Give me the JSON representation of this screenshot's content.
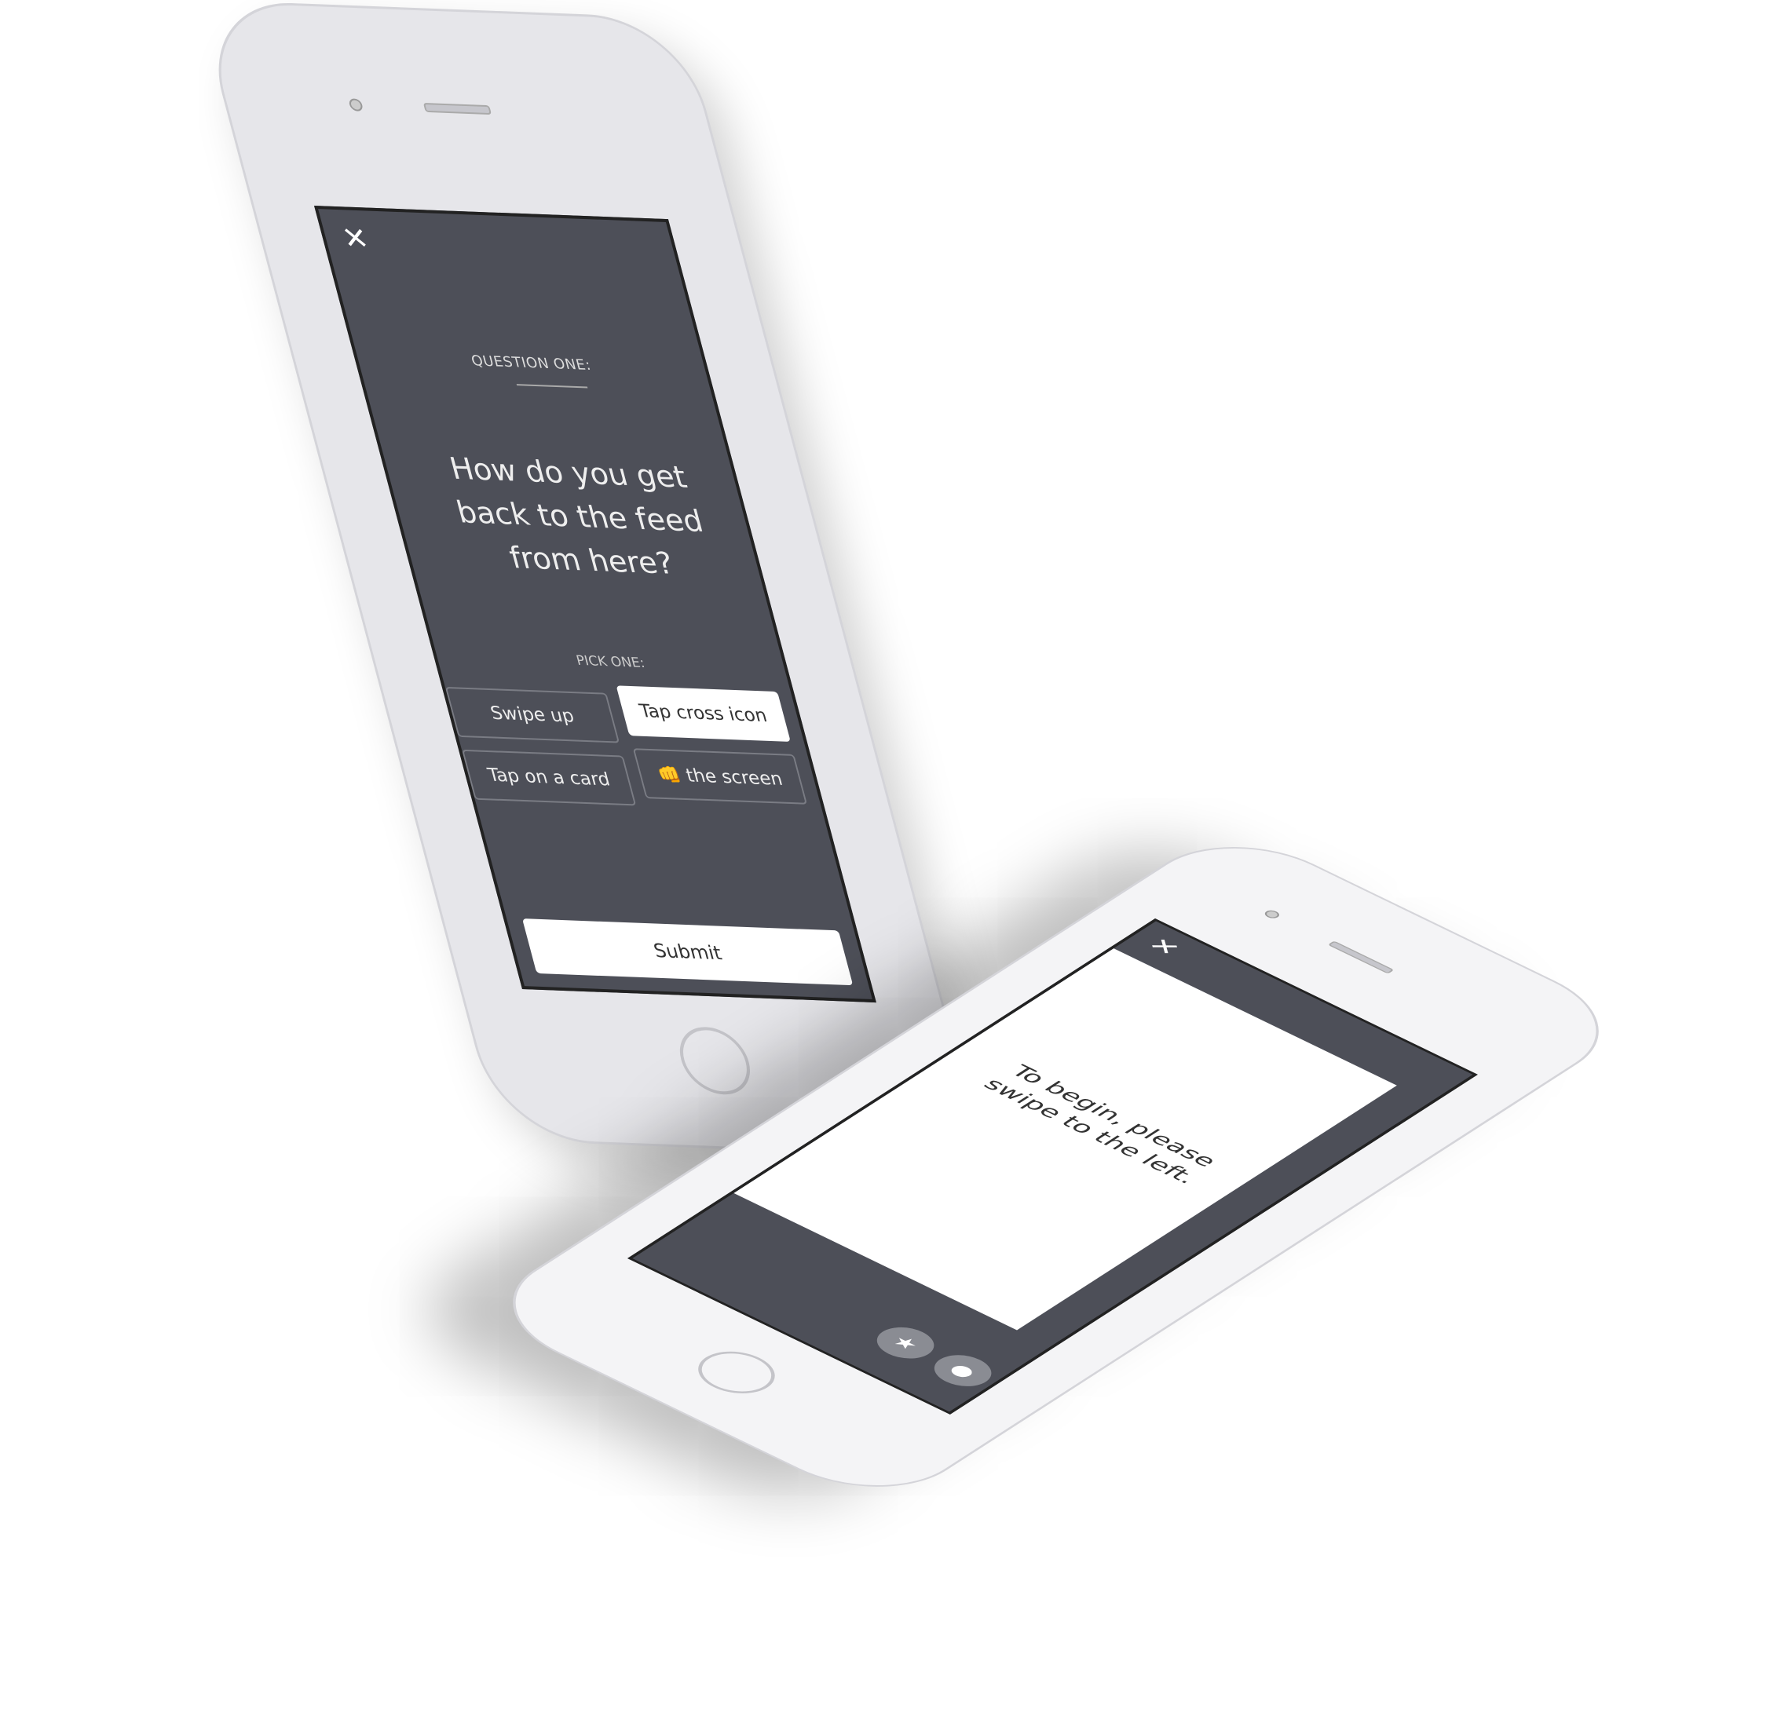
{
  "phone_quiz": {
    "close_icon": "close-icon",
    "question_label": "QUESTION ONE:",
    "question": "How do you get back to the feed from here?",
    "pick_label": "PICK ONE:",
    "options": [
      {
        "label": "Swipe up",
        "selected": false
      },
      {
        "label": "Tap cross icon",
        "selected": true
      },
      {
        "label": "Tap on a card",
        "selected": false
      },
      {
        "label": "👊 the screen",
        "selected": false
      }
    ],
    "submit_label": "Submit"
  },
  "phone_onboarding": {
    "close_icon": "close-icon",
    "card_text": "To begin, please swipe to the left.",
    "buttons": [
      {
        "icon": "star-icon",
        "glyph": "★"
      },
      {
        "icon": "chat-bubble-icon",
        "glyph": "●"
      }
    ]
  },
  "colors": {
    "screen": "#4d4f58",
    "phone_body": "#e6e6ea",
    "accent": "#ffffff"
  }
}
